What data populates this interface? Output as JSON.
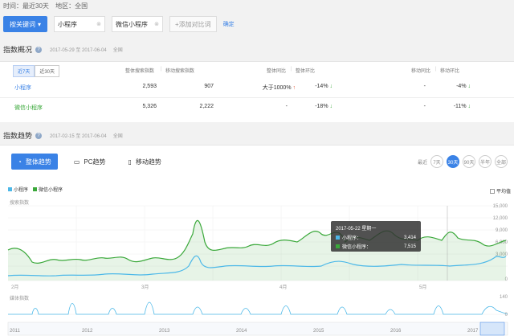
{
  "filters": {
    "time_label": "时间：最近30天",
    "region_label": "地区：全国"
  },
  "keywords": {
    "primary_button": "按关键词",
    "terms": [
      "小程序",
      "微信小程序"
    ],
    "add_compare": "+添加对比词",
    "confirm": "确定"
  },
  "overview": {
    "title": "指数概况",
    "range": "2017-05-29 至 2017-06-04",
    "scope": "全国",
    "tabs": [
      "近7天",
      "近30天"
    ],
    "headers": {
      "search_idx": "整体搜索指数",
      "mobile_idx": "移动搜索指数",
      "yoy1": "整体同比",
      "mom1": "整体环比",
      "yoy2": "移动同比",
      "mom2": "移动环比"
    },
    "rows": [
      {
        "name": "小程序",
        "search": "2,593",
        "mobile": "907",
        "yoy": "大于1000%",
        "yoy_dir": "up",
        "mom": "-14%",
        "yoy_m": "-",
        "mom_m": "-4%"
      },
      {
        "name": "微信小程序",
        "search": "5,326",
        "mobile": "2,222",
        "yoy": "-",
        "yoy_dir": "",
        "mom": "-18%",
        "yoy_m": "-",
        "mom_m": "-11%"
      }
    ]
  },
  "trend": {
    "title": "指数趋势",
    "range": "2017-02-15 至 2017-06-04",
    "scope": "全国",
    "tabs": [
      "整体趋势",
      "PC趋势",
      "移动趋势"
    ],
    "range_label": "最近",
    "range_opts": [
      "7天",
      "30天",
      "90天",
      "半年",
      "全部"
    ],
    "legend": [
      "小程序",
      "微信小程序"
    ],
    "avg_label": "平均值",
    "search_axis_label": "搜索指数",
    "media_axis_label": "媒体指数",
    "y_ticks": [
      "15,000",
      "12,000",
      "9,000",
      "6,000",
      "3,000",
      "0"
    ],
    "x_months": [
      "2月",
      "3月",
      "4月",
      "5月"
    ],
    "years": [
      "2011",
      "2012",
      "2013",
      "2014",
      "2015",
      "2016",
      "2017"
    ],
    "media_ticks": [
      "140",
      "0"
    ],
    "tooltip": {
      "date": "2017-05-22 星期一",
      "s1_name": "小程序：",
      "s1_val": "3,414",
      "s2_name": "微信小程序：",
      "s2_val": "7,515"
    },
    "colors": {
      "s1": "#4cb8e8",
      "s2": "#3aa83a",
      "accent": "#3a82e6"
    }
  }
}
